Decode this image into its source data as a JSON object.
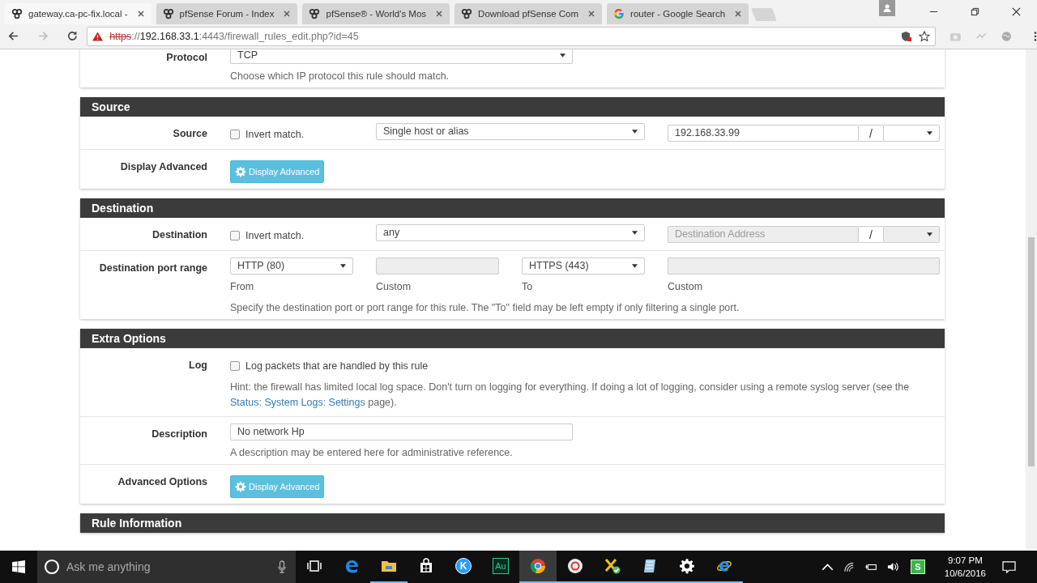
{
  "browser": {
    "tabs": [
      {
        "title": "gateway.ca-pc-fix.local -",
        "kind": "pfsense",
        "selected": true
      },
      {
        "title": "pfSense Forum - Index",
        "kind": "pfsense",
        "selected": false
      },
      {
        "title": "pfSense® - World's Mos",
        "kind": "pfsense",
        "selected": false
      },
      {
        "title": "Download pfSense Com",
        "kind": "pfsense",
        "selected": false
      },
      {
        "title": "router - Google Search",
        "kind": "google",
        "selected": false
      }
    ],
    "url": {
      "scheme": "https",
      "delimiter": "://",
      "host": "192.168.33.1",
      "path": ":4443/firewall_rules_edit.php?id=45"
    }
  },
  "protocol": {
    "label": "Protocol",
    "value": "TCP",
    "help": "Choose which IP protocol this rule should match."
  },
  "sections": [
    {
      "title": "Source",
      "rows": [
        {
          "kind": "address",
          "label": "Source",
          "invert": {
            "label": "Invert match.",
            "checked": false
          },
          "type": "Single host or alias",
          "address": {
            "value": "192.168.33.99",
            "disabled": false
          },
          "separator": "/"
        },
        {
          "kind": "button",
          "label": "Display Advanced",
          "button": "Display Advanced"
        }
      ]
    },
    {
      "title": "Destination",
      "rows": [
        {
          "kind": "address",
          "label": "Destination",
          "invert": {
            "label": "Invert match.",
            "checked": false
          },
          "type": "any",
          "address": {
            "placeholder": "Destination Address",
            "disabled": true
          },
          "separator": "/"
        },
        {
          "kind": "ports",
          "label": "Destination port range",
          "fields": [
            {
              "kind": "select",
              "value": "HTTP (80)",
              "caption": "From"
            },
            {
              "kind": "input",
              "caption": "Custom"
            },
            {
              "kind": "select",
              "value": "HTTPS (443)",
              "caption": "To"
            },
            {
              "kind": "input",
              "caption": "Custom"
            }
          ],
          "help": "Specify the destination port or port range for this rule. The \"To\" field may be left empty if only filtering a single port."
        }
      ]
    },
    {
      "title": "Extra Options",
      "rows": [
        {
          "kind": "checkbox",
          "label": "Log",
          "checkbox": {
            "label": "Log packets that are handled by this rule",
            "checked": false
          },
          "help": {
            "before": "Hint: the firewall has limited local log space. Don't turn on logging for everything. If doing a lot of logging, consider using a remote syslog server (see the ",
            "link": "Status: System Logs: Settings",
            "after": " page)."
          }
        },
        {
          "kind": "text",
          "label": "Description",
          "value": "No network Hp",
          "help": "A description may be entered here for administrative reference."
        },
        {
          "kind": "button",
          "label": "Advanced Options",
          "button": "Display Advanced"
        }
      ]
    },
    {
      "title": "Rule Information"
    }
  ],
  "taskbar": {
    "search": {
      "placeholder": "Ask me anything"
    },
    "apps": [
      {
        "kind": "taskview",
        "running": false,
        "active": false
      },
      {
        "kind": "edge",
        "running": false,
        "active": false
      },
      {
        "kind": "explorer",
        "running": true,
        "active": false
      },
      {
        "kind": "store",
        "running": false,
        "active": false
      },
      {
        "kind": "badge",
        "glyph": "K",
        "running": false,
        "active": false
      },
      {
        "kind": "audition",
        "glyph": "Au",
        "running": false,
        "active": false
      },
      {
        "kind": "chrome",
        "running": true,
        "active": true
      },
      {
        "kind": "ring",
        "running": true,
        "active": false
      },
      {
        "kind": "excel",
        "running": true,
        "active": false
      },
      {
        "kind": "notepad",
        "running": true,
        "active": false
      },
      {
        "kind": "settings",
        "running": true,
        "active": false
      },
      {
        "kind": "ie",
        "running": true,
        "active": false
      }
    ],
    "tray": {
      "glyph": "S",
      "time": "9:07 PM",
      "date": "10/6/2016"
    }
  }
}
